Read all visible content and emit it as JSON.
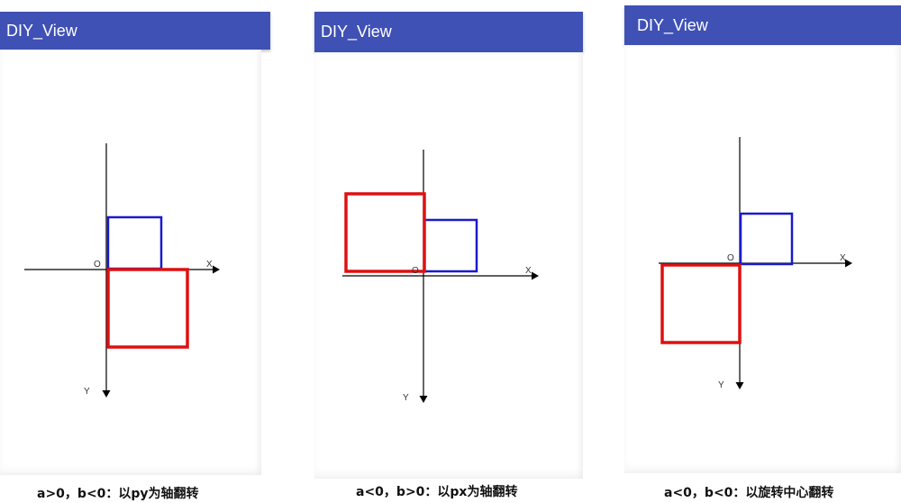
{
  "screens": [
    {
      "title": "DIY_View",
      "caption": "a>0，b<0：以py为轴翻转",
      "labels": {
        "origin": "O",
        "x": "X",
        "y": "Y"
      },
      "colors": {
        "original_rect": "#1a1acc",
        "transformed_rect": "#dd1111"
      }
    },
    {
      "title": "DIY_View",
      "caption": "a<0，b>0：以px为轴翻转",
      "labels": {
        "origin": "O",
        "x": "X",
        "y": "Y"
      },
      "colors": {
        "original_rect": "#1a1acc",
        "transformed_rect": "#dd1111"
      }
    },
    {
      "title": "DIY_View",
      "caption": "a<0，b<0：以旋转中心翻转",
      "labels": {
        "origin": "O",
        "x": "X",
        "y": "Y"
      },
      "colors": {
        "original_rect": "#1a1acc",
        "transformed_rect": "#dd1111"
      }
    }
  ],
  "colors": {
    "appbar": "#3F51B5",
    "axis": "#000000"
  }
}
